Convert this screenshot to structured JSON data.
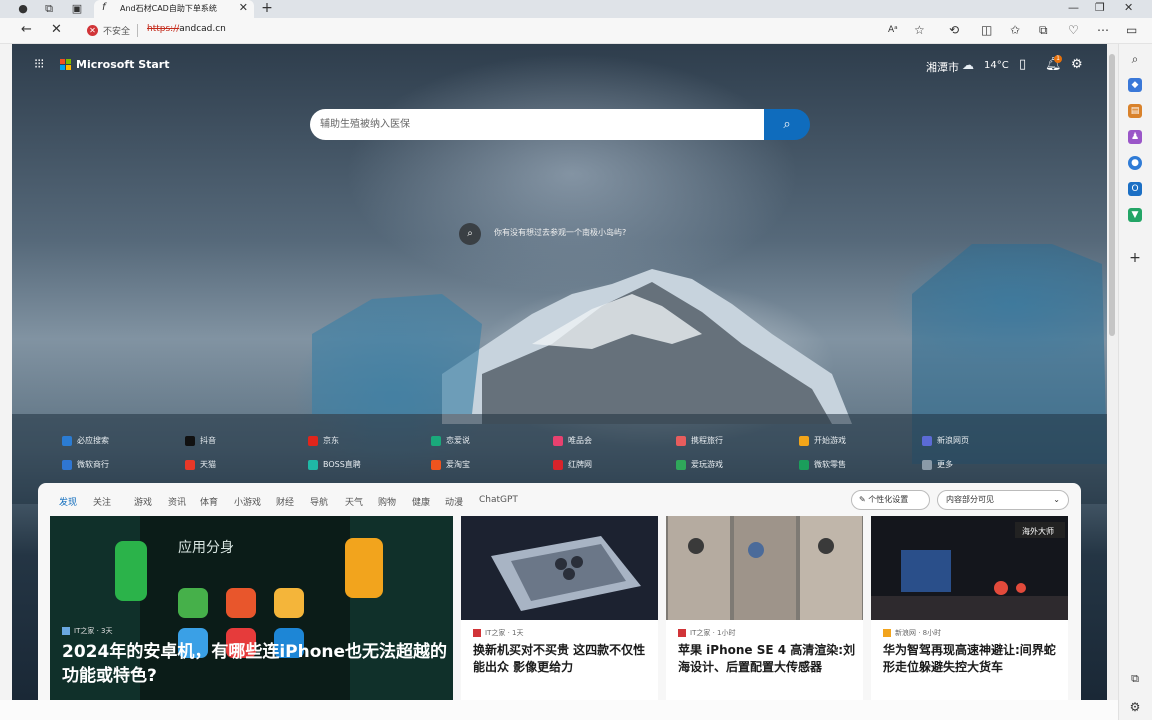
{
  "browser": {
    "tab_title": "And石材CAD自助下单系统",
    "tab_favicon": "f",
    "security_label": "不安全",
    "url_scheme": "https://",
    "url_host": "andcad.cn"
  },
  "header": {
    "brand": "Microsoft Start",
    "city": "湘潭市",
    "temperature": "14°C",
    "notification_count": "1"
  },
  "search": {
    "placeholder": "辅助生殖被纳入医保"
  },
  "hint": {
    "text": "你有没有想过去参观一个南极小岛屿?"
  },
  "quick_links": [
    {
      "label": "必应搜索",
      "color": "#2b7cd3"
    },
    {
      "label": "抖音",
      "color": "#111111"
    },
    {
      "label": "京东",
      "color": "#e1251b"
    },
    {
      "label": "恋爱说",
      "color": "#1aa97b"
    },
    {
      "label": "唯品会",
      "color": "#e8416f"
    },
    {
      "label": "携程旅行",
      "color": "#e85d5d"
    },
    {
      "label": "开始游戏",
      "color": "#f2a51a"
    },
    {
      "label": "新浪网页",
      "color": "#5b6bd6"
    },
    {
      "label": "微软商行",
      "color": "#2f76d2"
    },
    {
      "label": "天猫",
      "color": "#e83828"
    },
    {
      "label": "BOSS直聘",
      "color": "#1fb8a6"
    },
    {
      "label": "爱淘宝",
      "color": "#f0541e"
    },
    {
      "label": "红牌网",
      "color": "#d8232a"
    },
    {
      "label": "爱玩游戏",
      "color": "#2fa85a"
    },
    {
      "label": "微软零售",
      "color": "#1b9e5b"
    },
    {
      "label": "更多",
      "color": "#8a9aa8"
    }
  ],
  "feed": {
    "tabs": [
      "发现",
      "关注",
      "游戏",
      "资讯",
      "体育",
      "小游戏",
      "财经",
      "导航",
      "天气",
      "购物",
      "健康",
      "动漫",
      "ChatGPT"
    ],
    "personalize_label": "个性化设置",
    "visibility_label": "内容部分可见",
    "cards": [
      {
        "source": "IT之家 · 3天",
        "headline": "2024年的安卓机，有哪些连iPhone也无法超越的功能或特色?",
        "image_text": "应用分身"
      },
      {
        "source": "IT之家 · 1天",
        "headline": "换新机买对不买贵 这四款不仅性能出众 影像更给力"
      },
      {
        "source": "IT之家 · 1小时",
        "headline": "苹果 iPhone SE 4 高清渲染:刘海设计、后置配置大传感器"
      },
      {
        "source": "新浪网 · 8小时",
        "headline": "华为智驾再现高速神避让:间界蛇形走位躲避失控大货车",
        "image_text": "海外大师"
      }
    ]
  },
  "colors": {
    "accent": "#0f6cbd",
    "ms_red": "#f25022",
    "ms_green": "#7fba00",
    "ms_blue": "#00a4ef",
    "ms_yellow": "#ffb900"
  }
}
